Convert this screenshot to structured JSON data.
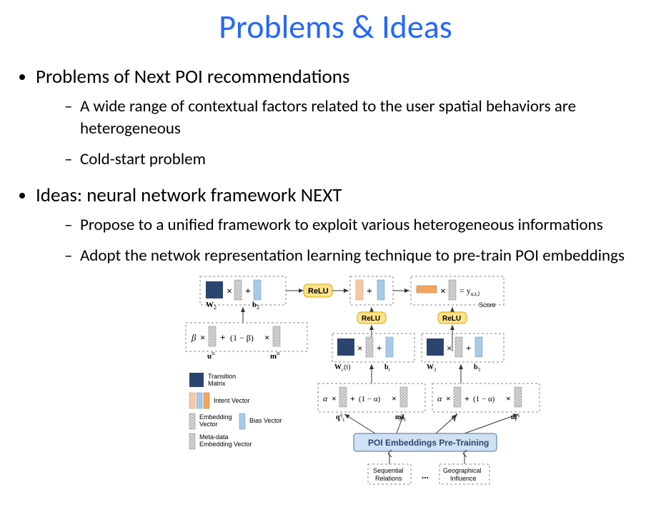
{
  "title": "Problems & Ideas",
  "bullets": {
    "b1": "Problems of Next POI recommendations",
    "b1a": "A wide range of contextual factors related to the user spatial behaviors are heterogeneous",
    "b1b": "Cold-start problem",
    "b2": "Ideas:  neural network framework NEXT",
    "b2a": "Propose to a unified framework to exploit various heterogeneous informations",
    "b2b": "Adopt the netwok representation learning technique to pre-train POI embeddings"
  },
  "diagram": {
    "relu": "ReLU",
    "W2": "W",
    "W2sub": "2",
    "b2": "b",
    "b2sub": "2",
    "beta": "β",
    "one_m_beta": "(1 − β)",
    "uu": "u",
    "uu_sup": "u",
    "mu": "m",
    "mu_sup": "u",
    "Wc": "W",
    "Wc_sub": "c",
    "Wc_arg": "(t)",
    "bt": "b",
    "bt_sub": "t",
    "bt_sup": "c",
    "W3": "W",
    "W3_sub": "3",
    "b3": "b",
    "b3_sub": "3",
    "alpha": "α",
    "one_m_alpha": "(1 − α)",
    "q_left": "q",
    "q_left_sup": "q",
    "q_left_sub": "i−1",
    "m_left": "m",
    "m_left_sup": "q",
    "m_left_sub": "i−1",
    "q_right": "q",
    "q_right_sup": "l",
    "m_right": "m",
    "m_right_sup": "q",
    "m_right_sub": "l",
    "score": "Score",
    "eq_y": "= y",
    "eq_y_sub": "u,t,l",
    "poi_box": "POI Embeddings Pre-Training",
    "seq_rel": "Sequential",
    "seq_rel2": "Relations",
    "dots": "...",
    "geo": "Geographical",
    "geo2": "Influence",
    "legend": {
      "transition": "Transition",
      "matrix": "Matrix",
      "intent": "Intent Vector",
      "embedding": "Embedding",
      "vector": "Vector",
      "bias": "Bias Vector",
      "meta": "Meta-data",
      "meta2": "Embedding Vector"
    }
  }
}
